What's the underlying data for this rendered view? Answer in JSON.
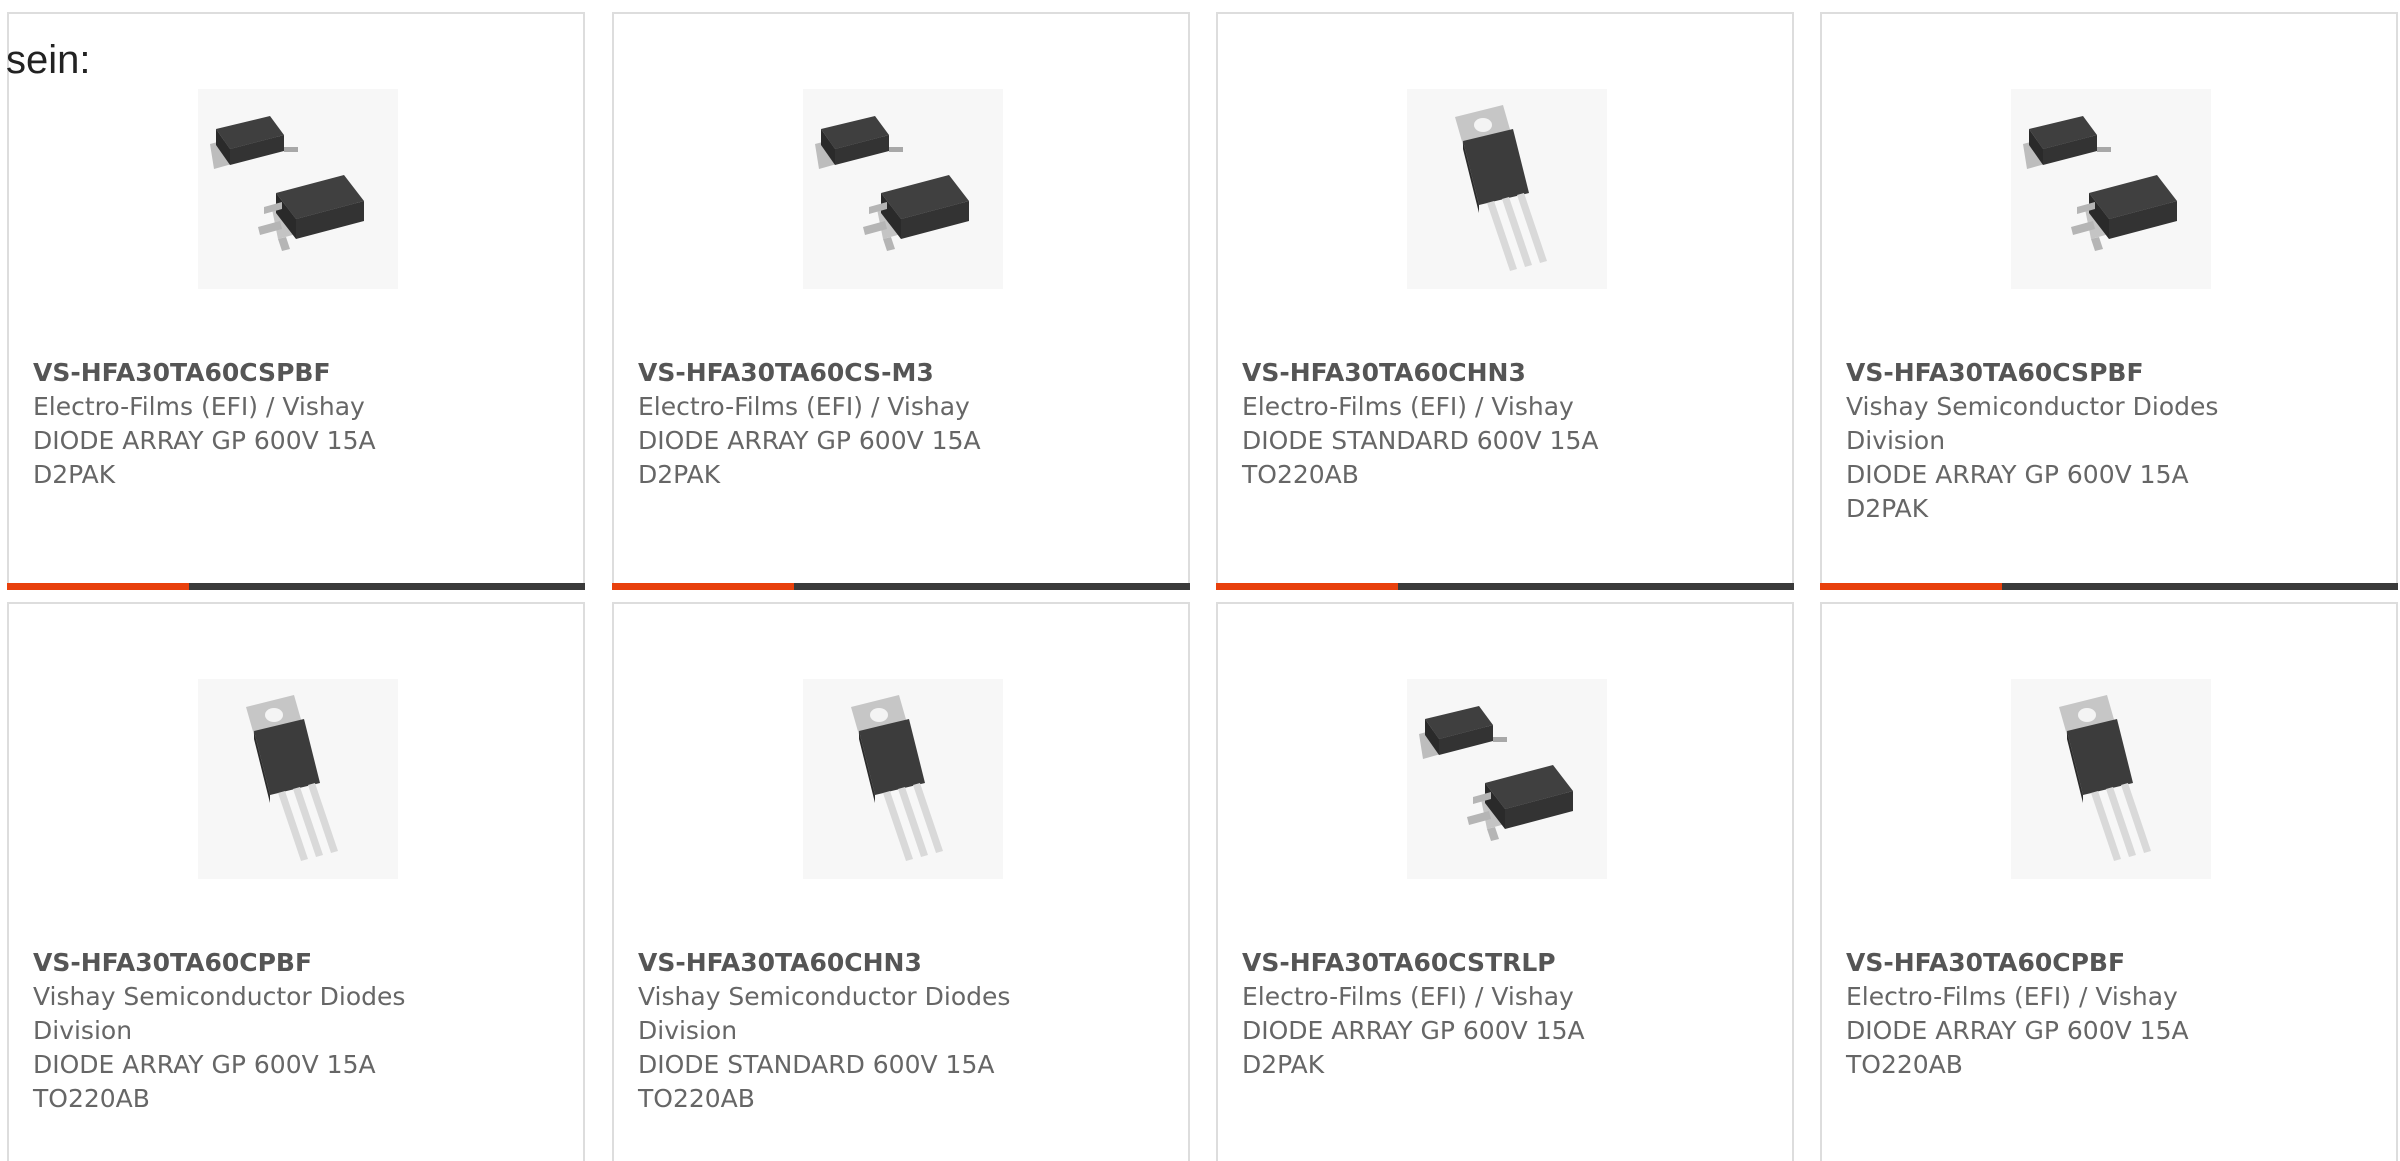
{
  "intro_text": "sein:",
  "colors": {
    "accent": "#e8400c",
    "bar_dark": "#3a3a3a",
    "text": "#666666",
    "border": "#dddddd"
  },
  "products": [
    {
      "part_number": "VS-HFA30TA60CSPBF",
      "manufacturer": "Electro-Films (EFI) / Vishay",
      "description": "DIODE ARRAY GP 600V 15A",
      "package": "D2PAK",
      "icon": "d2pak-package-icon"
    },
    {
      "part_number": "VS-HFA30TA60CS-M3",
      "manufacturer": "Electro-Films (EFI) / Vishay",
      "description": "DIODE ARRAY GP 600V 15A",
      "package": "D2PAK",
      "icon": "d2pak-package-icon"
    },
    {
      "part_number": "VS-HFA30TA60CHN3",
      "manufacturer": "Electro-Films (EFI) / Vishay",
      "description": "DIODE STANDARD 600V 15A",
      "package": "TO220AB",
      "icon": "to220-package-icon"
    },
    {
      "part_number": "VS-HFA30TA60CSPBF",
      "manufacturer": "Vishay Semiconductor Diodes",
      "manufacturer_cont": "Division",
      "description": "DIODE ARRAY GP 600V 15A",
      "package": "D2PAK",
      "icon": "d2pak-package-icon"
    },
    {
      "part_number": "VS-HFA30TA60CPBF",
      "manufacturer": "Vishay Semiconductor Diodes",
      "manufacturer_cont": "Division",
      "description": "DIODE ARRAY GP 600V 15A",
      "package": "TO220AB",
      "icon": "to220-package-icon"
    },
    {
      "part_number": "VS-HFA30TA60CHN3",
      "manufacturer": "Vishay Semiconductor Diodes",
      "manufacturer_cont": "Division",
      "description": "DIODE STANDARD 600V 15A",
      "package": "TO220AB",
      "icon": "to220-package-icon"
    },
    {
      "part_number": "VS-HFA30TA60CSTRLP",
      "manufacturer": "Electro-Films (EFI) / Vishay",
      "description": "DIODE ARRAY GP 600V 15A",
      "package": "D2PAK",
      "icon": "d2pak-package-icon"
    },
    {
      "part_number": "VS-HFA30TA60CPBF",
      "manufacturer": "Electro-Films (EFI) / Vishay",
      "description": "DIODE ARRAY GP 600V 15A",
      "package": "TO220AB",
      "icon": "to220-package-icon"
    }
  ]
}
